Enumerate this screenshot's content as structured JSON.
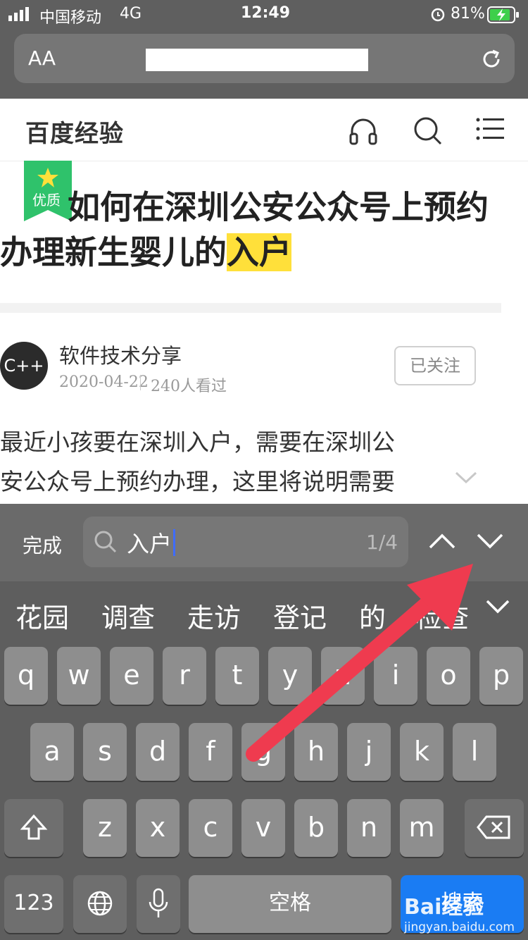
{
  "status_bar": {
    "carrier": "中国移动",
    "network": "4G",
    "time": "12:49",
    "battery": "81%"
  },
  "url_bar": {
    "text_size_label": "AA"
  },
  "site": {
    "title": "百度经验"
  },
  "article": {
    "badge": "优质",
    "title_pre": "如何在深圳公安公众号上预约办理新生婴儿的",
    "title_highlight": "入户",
    "author_avatar_text": "C++",
    "author": "软件技术分享",
    "date": "2020-04-22",
    "views": "240人看过",
    "follow_label": "已关注",
    "intro_line1": "最近小孩要在深圳入户，需要在深圳公",
    "intro_line2": "安公众号上预约办理，这里将说明需要"
  },
  "find_bar": {
    "done_label": "完成",
    "query": "入户",
    "count": "1/4"
  },
  "candidates": [
    "花园",
    "调查",
    "走访",
    "登记",
    "的",
    "检查"
  ],
  "keyboard": {
    "row1": [
      "q",
      "w",
      "e",
      "r",
      "t",
      "y",
      "u",
      "i",
      "o",
      "p"
    ],
    "row2": [
      "a",
      "s",
      "d",
      "f",
      "g",
      "h",
      "j",
      "k",
      "l"
    ],
    "row3": [
      "z",
      "x",
      "c",
      "v",
      "b",
      "n",
      "m"
    ],
    "numbers_label": "123",
    "space_label": "空格",
    "search_label": "搜索"
  },
  "watermark": {
    "brand": "Bai经验",
    "url": "jingyan.baidu.com"
  },
  "colors": {
    "highlight": "#ffe03a",
    "badge_green": "#2fc26b",
    "arrow_red": "#ef3b4f",
    "search_key_blue": "#1a7cf3"
  }
}
